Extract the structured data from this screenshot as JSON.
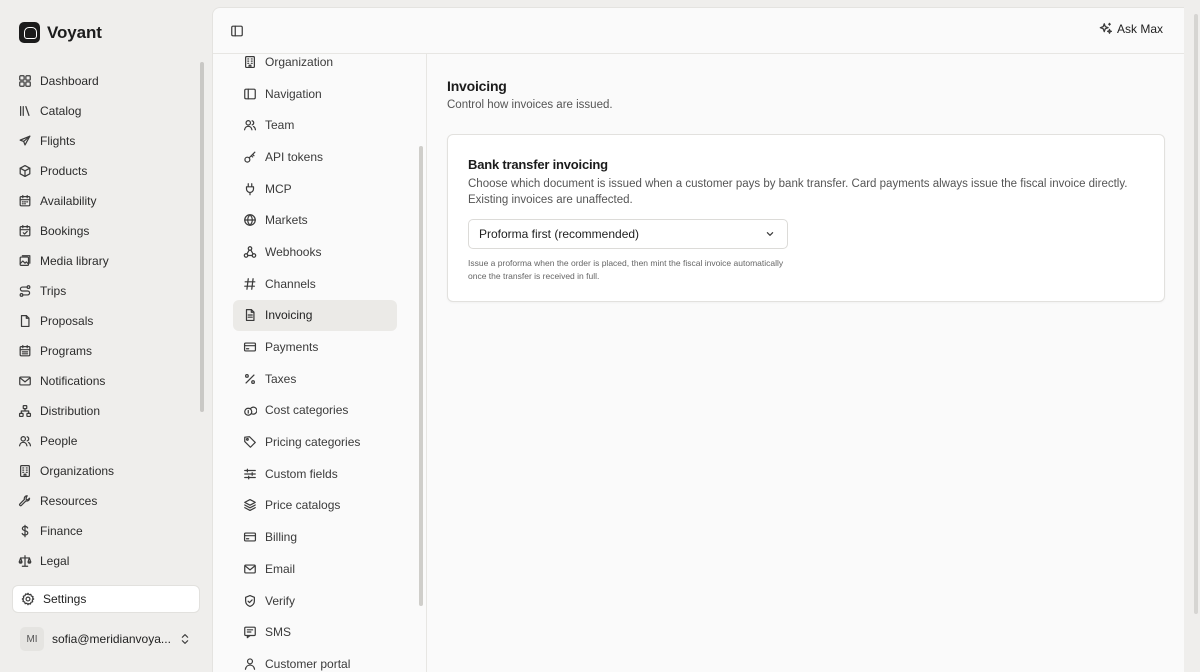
{
  "app": {
    "name": "Voyant"
  },
  "sidebar": {
    "items": [
      {
        "label": "Dashboard",
        "icon": "dashboard-icon"
      },
      {
        "label": "Catalog",
        "icon": "catalog-icon"
      },
      {
        "label": "Flights",
        "icon": "plane-icon"
      },
      {
        "label": "Products",
        "icon": "package-icon"
      },
      {
        "label": "Availability",
        "icon": "calendar-icon"
      },
      {
        "label": "Bookings",
        "icon": "calendar-check-icon"
      },
      {
        "label": "Media library",
        "icon": "image-icon"
      },
      {
        "label": "Trips",
        "icon": "route-icon"
      },
      {
        "label": "Proposals",
        "icon": "file-icon"
      },
      {
        "label": "Programs",
        "icon": "calendar-days-icon"
      },
      {
        "label": "Notifications",
        "icon": "mail-icon"
      },
      {
        "label": "Distribution",
        "icon": "network-icon"
      },
      {
        "label": "People",
        "icon": "users-icon"
      },
      {
        "label": "Organizations",
        "icon": "building-icon"
      },
      {
        "label": "Resources",
        "icon": "wrench-icon"
      },
      {
        "label": "Finance",
        "icon": "dollar-icon"
      },
      {
        "label": "Legal",
        "icon": "scale-icon"
      }
    ],
    "settings_label": "Settings",
    "user": {
      "initials": "MI",
      "email": "sofia@meridianvoya..."
    }
  },
  "topbar": {
    "ask_label": "Ask Max"
  },
  "settings_nav": {
    "items": [
      {
        "label": "Organization",
        "icon": "building-icon"
      },
      {
        "label": "Navigation",
        "icon": "panel-icon"
      },
      {
        "label": "Team",
        "icon": "users-icon"
      },
      {
        "label": "API tokens",
        "icon": "key-icon"
      },
      {
        "label": "MCP",
        "icon": "plug-icon"
      },
      {
        "label": "Markets",
        "icon": "globe-icon"
      },
      {
        "label": "Webhooks",
        "icon": "webhook-icon"
      },
      {
        "label": "Channels",
        "icon": "hash-icon"
      },
      {
        "label": "Invoicing",
        "icon": "file-text-icon",
        "active": true
      },
      {
        "label": "Payments",
        "icon": "credit-card-icon"
      },
      {
        "label": "Taxes",
        "icon": "percent-icon"
      },
      {
        "label": "Cost categories",
        "icon": "coins-icon"
      },
      {
        "label": "Pricing categories",
        "icon": "tag-icon"
      },
      {
        "label": "Custom fields",
        "icon": "sliders-icon"
      },
      {
        "label": "Price catalogs",
        "icon": "layers-icon"
      },
      {
        "label": "Billing",
        "icon": "credit-card-icon"
      },
      {
        "label": "Email",
        "icon": "mail-icon"
      },
      {
        "label": "Verify",
        "icon": "shield-check-icon"
      },
      {
        "label": "SMS",
        "icon": "message-icon"
      },
      {
        "label": "Customer portal",
        "icon": "user-icon"
      }
    ]
  },
  "page": {
    "title": "Invoicing",
    "subtitle": "Control how invoices are issued."
  },
  "bank_transfer": {
    "title": "Bank transfer invoicing",
    "description": "Choose which document is issued when a customer pays by bank transfer. Card payments always issue the fiscal invoice directly. Existing invoices are unaffected.",
    "select_value": "Proforma first (recommended)",
    "hint": "Issue a proforma when the order is placed, then mint the fiscal invoice automatically once the transfer is received in full."
  }
}
